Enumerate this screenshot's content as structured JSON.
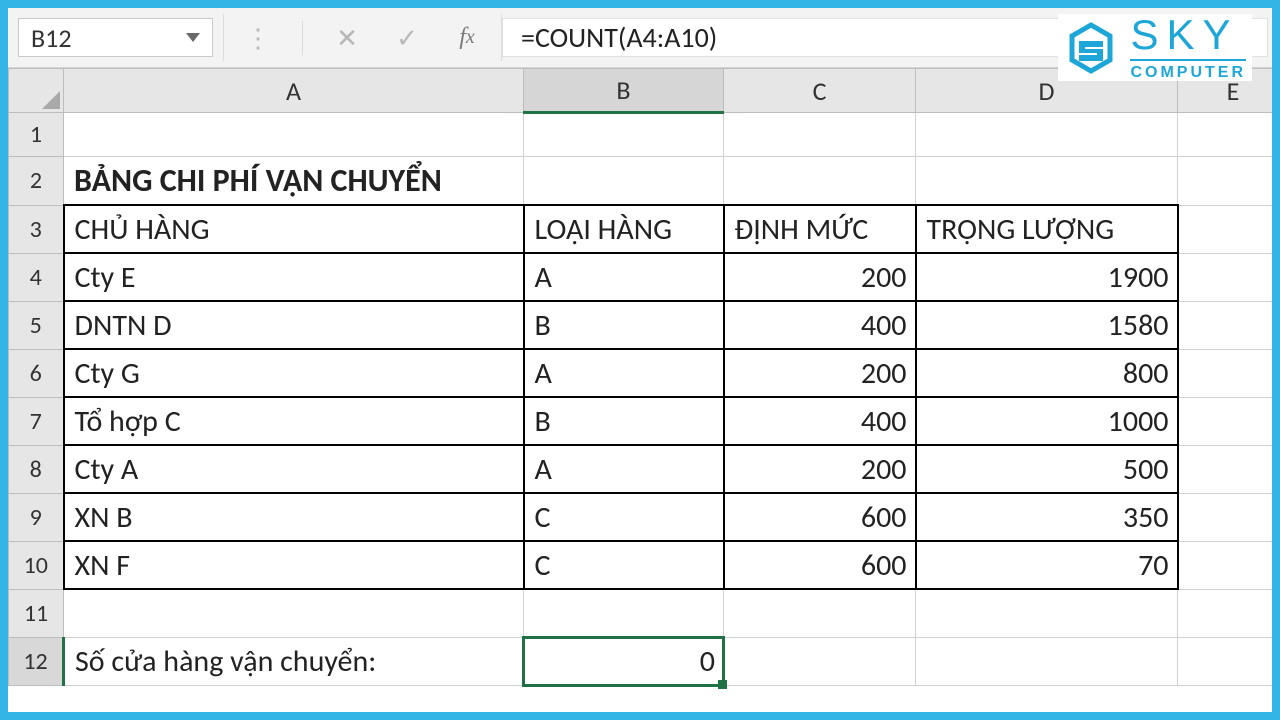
{
  "name_box": "B12",
  "formula": "=COUNT(A4:A10)",
  "logo": {
    "line1": "SKY",
    "line2": "COMPUTER"
  },
  "columns": [
    "A",
    "B",
    "C",
    "D",
    "E"
  ],
  "active_column_index": 1,
  "rows": [
    "1",
    "2",
    "3",
    "4",
    "5",
    "6",
    "7",
    "8",
    "9",
    "10",
    "11",
    "12"
  ],
  "active_row_index": 11,
  "title": "BẢNG CHI PHÍ VẬN CHUYỂN",
  "headers": {
    "A": "CHỦ HÀNG",
    "B": "LOẠI HÀNG",
    "C": "ĐỊNH MỨC",
    "D": "TRỌNG LƯỢNG"
  },
  "data": [
    {
      "A": "Cty E",
      "B": "A",
      "C": "200",
      "D": "1900"
    },
    {
      "A": "DNTN D",
      "B": "B",
      "C": "400",
      "D": "1580"
    },
    {
      "A": "Cty G",
      "B": "A",
      "C": "200",
      "D": "800"
    },
    {
      "A": "Tổ hợp C",
      "B": "B",
      "C": "400",
      "D": "1000"
    },
    {
      "A": "Cty A",
      "B": "A",
      "C": "200",
      "D": "500"
    },
    {
      "A": "XN B",
      "B": "C",
      "C": "600",
      "D": "350"
    },
    {
      "A": "XN F",
      "B": "C",
      "C": "600",
      "D": "70"
    }
  ],
  "footer": {
    "label": "Số cửa hàng vận chuyển:",
    "value": "0"
  },
  "chart_data": {
    "type": "table",
    "title": "BẢNG CHI PHÍ VẬN CHUYỂN",
    "columns": [
      "CHỦ HÀNG",
      "LOẠI HÀNG",
      "ĐỊNH MỨC",
      "TRỌNG LƯỢNG"
    ],
    "rows": [
      [
        "Cty E",
        "A",
        200,
        1900
      ],
      [
        "DNTN D",
        "B",
        400,
        1580
      ],
      [
        "Cty G",
        "A",
        200,
        800
      ],
      [
        "Tổ hợp C",
        "B",
        400,
        1000
      ],
      [
        "Cty A",
        "A",
        200,
        500
      ],
      [
        "XN B",
        "C",
        600,
        350
      ],
      [
        "XN F",
        "C",
        600,
        70
      ]
    ]
  }
}
